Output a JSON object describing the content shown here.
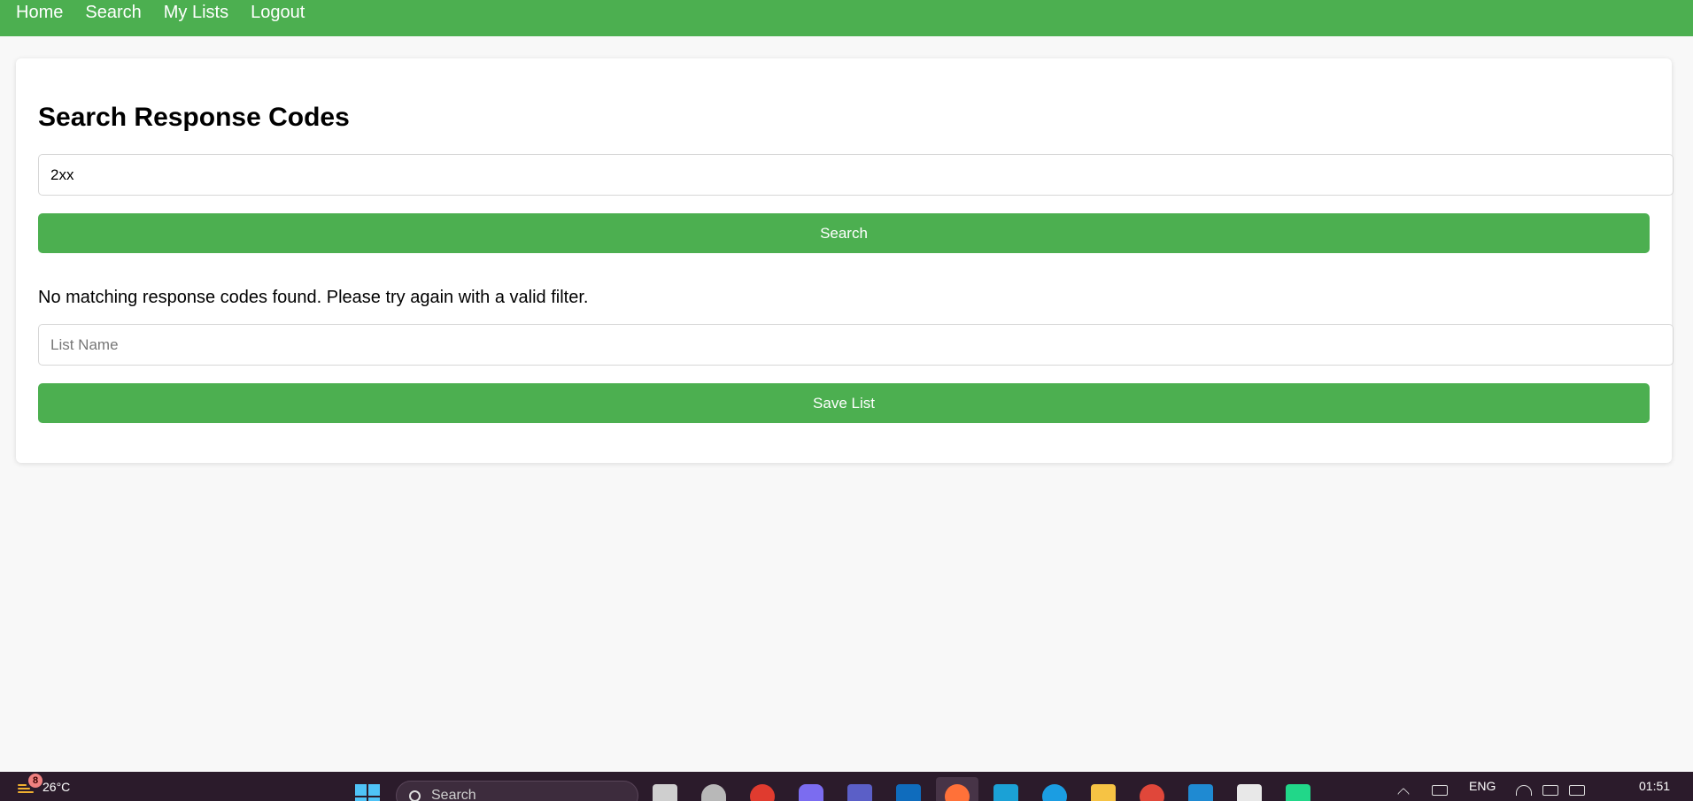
{
  "nav": {
    "links": [
      "Home",
      "Search",
      "My Lists",
      "Logout"
    ],
    "bg_color": "#4caf50"
  },
  "main": {
    "heading": "Search Response Codes",
    "filter_value": "2xx",
    "search_button": "Search",
    "message": "No matching response codes found. Please try again with a valid filter.",
    "list_name_placeholder": "List Name",
    "save_button": "Save List"
  },
  "taskbar": {
    "weather_badge": "8",
    "temperature": "26°C",
    "search_label": "Search",
    "language": "ENG",
    "time": "01:51",
    "apps": [
      "file-explorer-icon",
      "database-icon",
      "vivaldi-icon",
      "copilot-icon",
      "teams-icon",
      "outlook-icon",
      "firefox-icon",
      "app-icon",
      "edge-icon",
      "folder-icon",
      "chrome-icon",
      "vscode-icon",
      "slack-icon",
      "pycharm-icon"
    ]
  }
}
